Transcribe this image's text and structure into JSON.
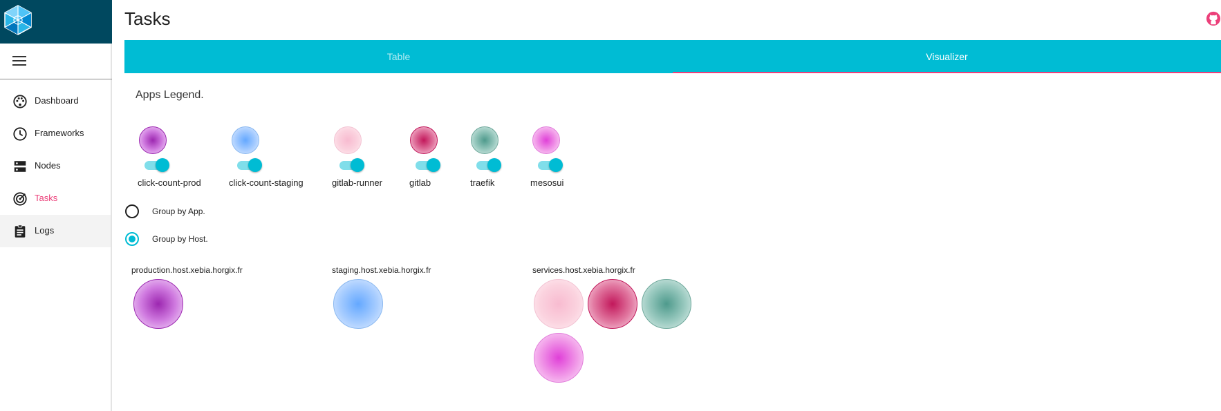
{
  "page": {
    "title": "Tasks"
  },
  "sidebar": {
    "items": [
      {
        "label": "Dashboard",
        "icon": "palette-icon"
      },
      {
        "label": "Frameworks",
        "icon": "clock-icon"
      },
      {
        "label": "Nodes",
        "icon": "dns-icon"
      },
      {
        "label": "Tasks",
        "icon": "track-changes-icon",
        "active": true
      },
      {
        "label": "Logs",
        "icon": "clipboard-icon"
      }
    ]
  },
  "tabs": [
    {
      "label": "Table"
    },
    {
      "label": "Visualizer",
      "selected": true
    }
  ],
  "legend": {
    "title": "Apps Legend.",
    "apps": [
      {
        "name": "click-count-prod",
        "color": "#9c27b0",
        "enabled": true
      },
      {
        "name": "click-count-staging",
        "color": "#64a8ff",
        "enabled": true
      },
      {
        "name": "gitlab-runner",
        "color": "#f8bbd0",
        "enabled": true
      },
      {
        "name": "gitlab",
        "color": "#c2185b",
        "enabled": true
      },
      {
        "name": "traefik",
        "color": "#4e9a8c",
        "enabled": true
      },
      {
        "name": "mesosui",
        "color": "#e040d8",
        "enabled": true
      }
    ]
  },
  "grouping": {
    "options": [
      {
        "label": "Group by App.",
        "selected": false
      },
      {
        "label": "Group by Host.",
        "selected": true
      }
    ]
  },
  "hosts": [
    {
      "name": "production.host.xebia.horgix.fr",
      "apps": [
        "click-count-prod"
      ]
    },
    {
      "name": "staging.host.xebia.horgix.fr",
      "apps": [
        "click-count-staging"
      ]
    },
    {
      "name": "services.host.xebia.horgix.fr",
      "apps": [
        "gitlab-runner",
        "gitlab",
        "traefik",
        "mesosui"
      ]
    }
  ],
  "colors": {
    "accent": "#00bcd4",
    "active": "#ec407a",
    "brand": "#00485f"
  }
}
